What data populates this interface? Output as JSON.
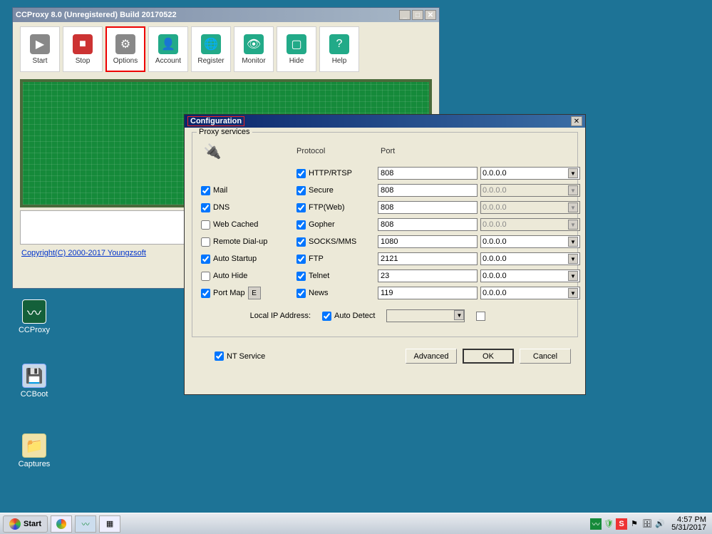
{
  "main": {
    "title": "CCProxy 8.0 (Unregistered) Build 20170522",
    "toolbar": [
      {
        "label": "Start",
        "key": "start"
      },
      {
        "label": "Stop",
        "key": "stop"
      },
      {
        "label": "Options",
        "key": "options"
      },
      {
        "label": "Account",
        "key": "account"
      },
      {
        "label": "Register",
        "key": "register"
      },
      {
        "label": "Monitor",
        "key": "monitor"
      },
      {
        "label": "Hide",
        "key": "hide"
      },
      {
        "label": "Help",
        "key": "help"
      }
    ],
    "logo": "CCProxy",
    "copyright": "Copyright(C) 2000-2017 Youngzsoft"
  },
  "config": {
    "title": "Configuration",
    "fieldset_label": "Proxy services",
    "head_protocol": "Protocol",
    "head_port": "Port",
    "left_services": [
      {
        "label": "Mail",
        "checked": true
      },
      {
        "label": "DNS",
        "checked": true
      },
      {
        "label": "Web Cached",
        "checked": false
      },
      {
        "label": "Remote Dial-up",
        "checked": false
      },
      {
        "label": "Auto Startup",
        "checked": true
      },
      {
        "label": "Auto Hide",
        "checked": false
      },
      {
        "label": "Port Map",
        "checked": true
      }
    ],
    "rows": [
      {
        "proto": "HTTP/RTSP",
        "pchecked": true,
        "port": "808",
        "ip": "0.0.0.0",
        "ip_disabled": false
      },
      {
        "proto": "Secure",
        "pchecked": true,
        "port": "808",
        "ip": "0.0.0.0",
        "ip_disabled": true
      },
      {
        "proto": "FTP(Web)",
        "pchecked": true,
        "port": "808",
        "ip": "0.0.0.0",
        "ip_disabled": true
      },
      {
        "proto": "Gopher",
        "pchecked": true,
        "port": "808",
        "ip": "0.0.0.0",
        "ip_disabled": true
      },
      {
        "proto": "SOCKS/MMS",
        "pchecked": true,
        "port": "1080",
        "ip": "0.0.0.0",
        "ip_disabled": false
      },
      {
        "proto": "FTP",
        "pchecked": true,
        "port": "2121",
        "ip": "0.0.0.0",
        "ip_disabled": false
      },
      {
        "proto": "Telnet",
        "pchecked": true,
        "port": "23",
        "ip": "0.0.0.0",
        "ip_disabled": false
      },
      {
        "proto": "News",
        "pchecked": true,
        "port": "119",
        "ip": "0.0.0.0",
        "ip_disabled": false
      }
    ],
    "e_btn": "E",
    "local_ip_label": "Local IP Address:",
    "auto_detect": "Auto Detect",
    "nt_service": "NT Service",
    "btn_advanced": "Advanced",
    "btn_ok": "OK",
    "btn_cancel": "Cancel"
  },
  "desktop": {
    "ccproxy": "CCProxy",
    "ccboot": "CCBoot",
    "captures": "Captures"
  },
  "taskbar": {
    "start": "Start",
    "time": "4:57 PM",
    "date": "5/31/2017"
  }
}
